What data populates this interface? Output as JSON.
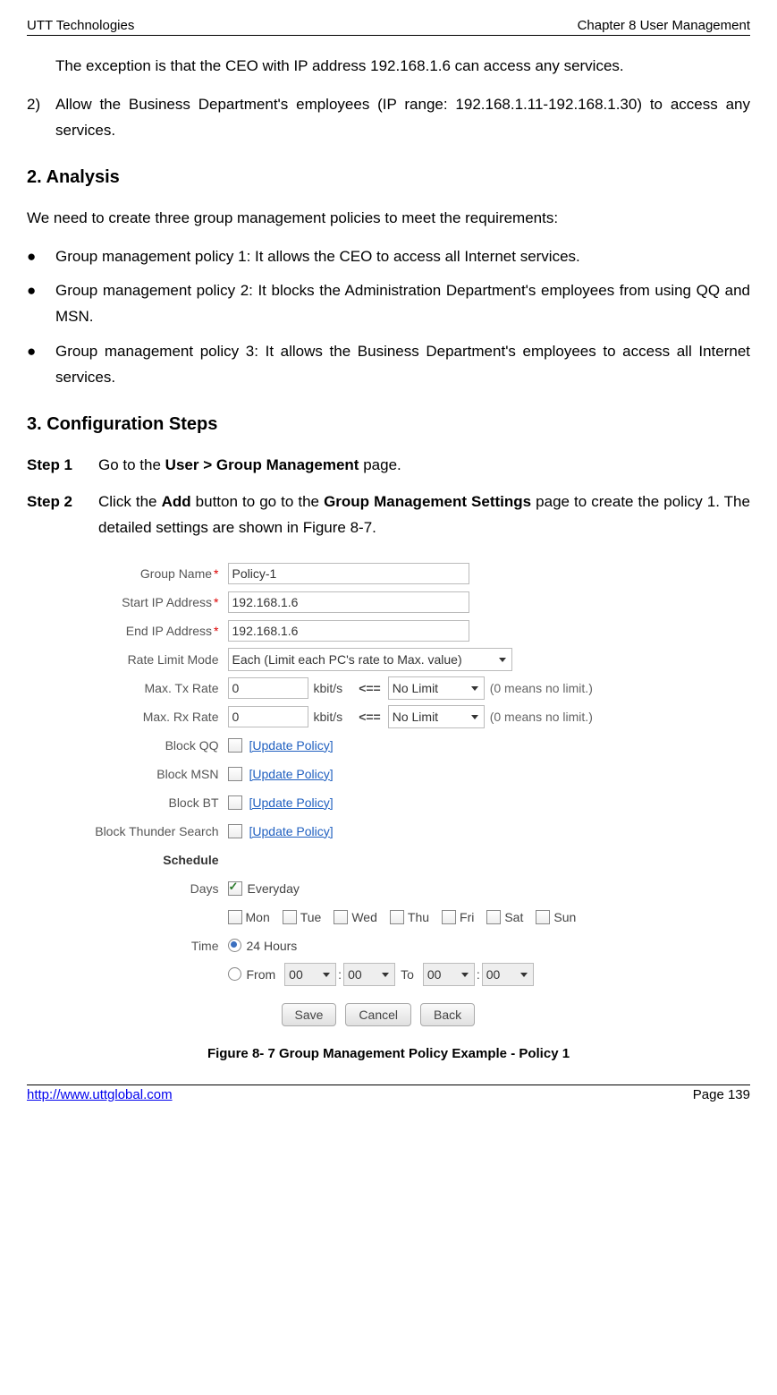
{
  "header": {
    "left": "UTT Technologies",
    "right": "Chapter 8 User Management"
  },
  "para_exception": "The exception is that the CEO with IP address 192.168.1.6 can access any services.",
  "req2_marker": "2)",
  "req2_text": "Allow the Business Department's employees (IP range: 192.168.1.11-192.168.1.30) to access any services.",
  "section_analysis": "2.    Analysis",
  "analysis_intro": "We need to create three group management policies to meet the requirements:",
  "bullets": [
    "Group management policy 1: It allows the CEO to access all Internet services.",
    "Group management policy 2: It blocks the Administration Department's employees from using QQ and MSN.",
    "Group management policy 3: It allows the Business Department's employees to access all Internet services."
  ],
  "section_steps": "3.    Configuration Steps",
  "step1_label": "Step 1",
  "step1_text_a": "Go to the ",
  "step1_text_b": "User > Group Management",
  "step1_text_c": " page.",
  "step2_label": "Step 2",
  "step2_text_a": "Click the ",
  "step2_text_b": "Add",
  "step2_text_c": " button to go to the ",
  "step2_text_d": "Group Management Settings",
  "step2_text_e": " page to create the policy 1. The detailed settings are shown in Figure 8-7.",
  "form": {
    "labels": {
      "group_name": "Group Name",
      "start_ip": "Start IP Address",
      "end_ip": "End IP Address",
      "rate_mode": "Rate Limit Mode",
      "max_tx": "Max. Tx Rate",
      "max_rx": "Max. Rx Rate",
      "block_qq": "Block QQ",
      "block_msn": "Block MSN",
      "block_bt": "Block BT",
      "block_thunder": "Block Thunder Search",
      "schedule": "Schedule",
      "days": "Days",
      "time": "Time"
    },
    "values": {
      "group_name": "Policy-1",
      "start_ip": "192.168.1.6",
      "end_ip": "192.168.1.6",
      "rate_mode": "Each (Limit each PC's rate to Max. value)",
      "max_tx": "0",
      "max_rx": "0",
      "no_limit": "No Limit",
      "time_val": "00"
    },
    "hints": {
      "kbits": "kbit/s",
      "arrow": "<==",
      "zero_means": "(0 means no limit.)",
      "update_policy": "[Update Policy]"
    },
    "days": {
      "everyday": "Everyday",
      "list": [
        "Mon",
        "Tue",
        "Wed",
        "Thu",
        "Fri",
        "Sat",
        "Sun"
      ]
    },
    "time": {
      "opt_24": "24 Hours",
      "opt_from": "From",
      "to": "To"
    },
    "buttons": {
      "save": "Save",
      "cancel": "Cancel",
      "back": "Back"
    }
  },
  "figure_caption": "Figure 8- 7 Group Management Policy Example - Policy 1",
  "footer": {
    "link": "http://www.uttglobal.com",
    "page": "Page 139"
  }
}
